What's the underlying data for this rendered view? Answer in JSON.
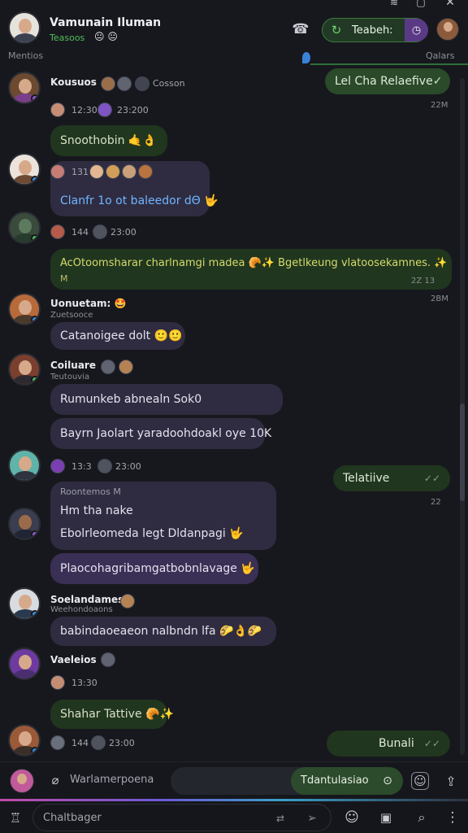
{
  "header": {
    "contact_name": "Vamunain Iluman",
    "status": "Teasoos",
    "status_emoji": "😐 😐",
    "action_label": "Teabeh:",
    "left_caption": "Mentios",
    "right_caption": "Qalars"
  },
  "messages": [
    {
      "sender": "Kousuos",
      "extra": "Cosson",
      "meta": "12:30",
      "meta2": "23:200",
      "text": "Snoothobin 🤙👌"
    },
    {
      "meta": "131",
      "text": "Clanfr 1o ot baleedor dΘ 🤟"
    },
    {
      "meta": "144",
      "meta2": "23:00",
      "text": "AcOtoomsharar charlnamgi madea 🥐✨ Bgetlkeung vlatoosekamnes. ✨",
      "text2": "M",
      "time": "2Z 13"
    },
    {
      "sender": "Uonuetam: 🤩",
      "sub": "Zuetsooce",
      "text": "Catanoigee dolt 🙂🙂"
    },
    {
      "sender": "Coiluare",
      "sub": "Teutouvia",
      "text": "Rumunkeb abnealn Sok0",
      "text2": "Bayrn Jaolart yaradoohdoakl oye 10K"
    },
    {
      "meta": "13:3",
      "meta2": "23:00",
      "header": "Roontemos M",
      "text": "Hm tha nake",
      "text2": "Ebolrleomeda legt Dldanpagi 🤟",
      "text3": "Plaocohagribamgatbobnlavage 🤟"
    },
    {
      "sender": "Soelandamest.",
      "sub": "Weehondoaons",
      "text": "babindaoeaeon nalbndn lfa 🌮👌🌮"
    },
    {
      "sender": "Vaeleios",
      "meta": "13:30",
      "text": "Shahar Tattive 🥐✨"
    },
    {
      "meta": "144",
      "meta2": "23:00"
    }
  ],
  "outgoing": [
    {
      "text": "Lel Cha Relaefive",
      "time": "22M"
    },
    {
      "text": "Telatiive",
      "time": "22"
    },
    {
      "text": "Bunali",
      "time": ""
    }
  ],
  "input": {
    "placeholder": "Warlamerpoena",
    "pill_label": "Tdantulasiao",
    "footer_placeholder": "Chaltbager"
  }
}
